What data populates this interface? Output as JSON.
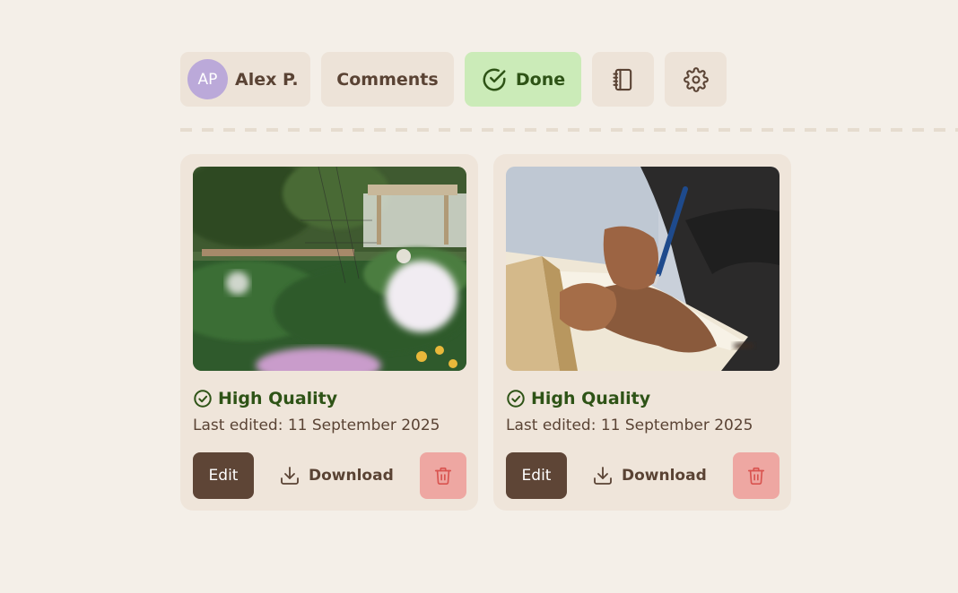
{
  "toolbar": {
    "user": {
      "initials": "AP",
      "name": "Alex P."
    },
    "comments_label": "Comments",
    "done_label": "Done"
  },
  "colors": {
    "background": "#f4efe8",
    "chip": "#ede3d8",
    "done_chip": "#cbebb8",
    "avatar": "#bba9d9",
    "quality_text": "#2e5316",
    "edit_button": "#5e4536",
    "delete_button": "#eea7a2",
    "delete_icon": "#d9534f"
  },
  "cards": [
    {
      "image": "garden-photo",
      "quality_label": "High Quality",
      "last_edited": "Last edited: 11 September 2025",
      "edit_label": "Edit",
      "download_label": "Download"
    },
    {
      "image": "journal-writing-photo",
      "quality_label": "High Quality",
      "last_edited": "Last edited: 11 September 2025",
      "edit_label": "Edit",
      "download_label": "Download"
    }
  ]
}
